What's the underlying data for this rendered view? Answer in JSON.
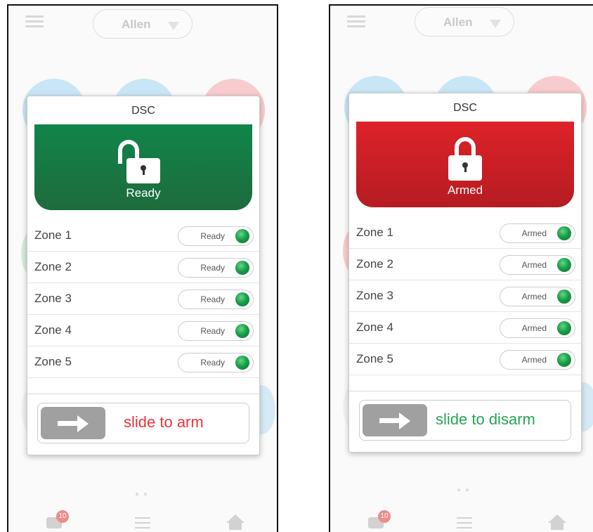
{
  "screens": [
    {
      "user": "Allen",
      "dialog_title": "DSC",
      "state": "Ready",
      "zones": [
        {
          "name": "Zone 1",
          "status": "Ready"
        },
        {
          "name": "Zone 2",
          "status": "Ready"
        },
        {
          "name": "Zone 3",
          "status": "Ready"
        },
        {
          "name": "Zone 4",
          "status": "Ready"
        },
        {
          "name": "Zone 5",
          "status": "Ready"
        }
      ],
      "slider_label": "slide to arm",
      "notification_count": "10"
    },
    {
      "user": "Allen",
      "dialog_title": "DSC",
      "state": "Armed",
      "zones": [
        {
          "name": "Zone 1",
          "status": "Armed"
        },
        {
          "name": "Zone 2",
          "status": "Armed"
        },
        {
          "name": "Zone 3",
          "status": "Armed"
        },
        {
          "name": "Zone 4",
          "status": "Armed"
        },
        {
          "name": "Zone 5",
          "status": "Armed"
        }
      ],
      "slider_label": "slide to disarm",
      "notification_count": "10"
    }
  ],
  "colors": {
    "ready_banner": "#10854a",
    "armed_banner": "#de2229",
    "arm_text": "#e5343c",
    "disarm_text": "#25a552",
    "zone_led": "#19a04a"
  },
  "icons": [
    "menu-icon",
    "dropdown-caret-icon",
    "lock-open-icon",
    "lock-closed-icon",
    "arrow-right-icon",
    "chat-icon",
    "list-icon",
    "home-icon"
  ]
}
